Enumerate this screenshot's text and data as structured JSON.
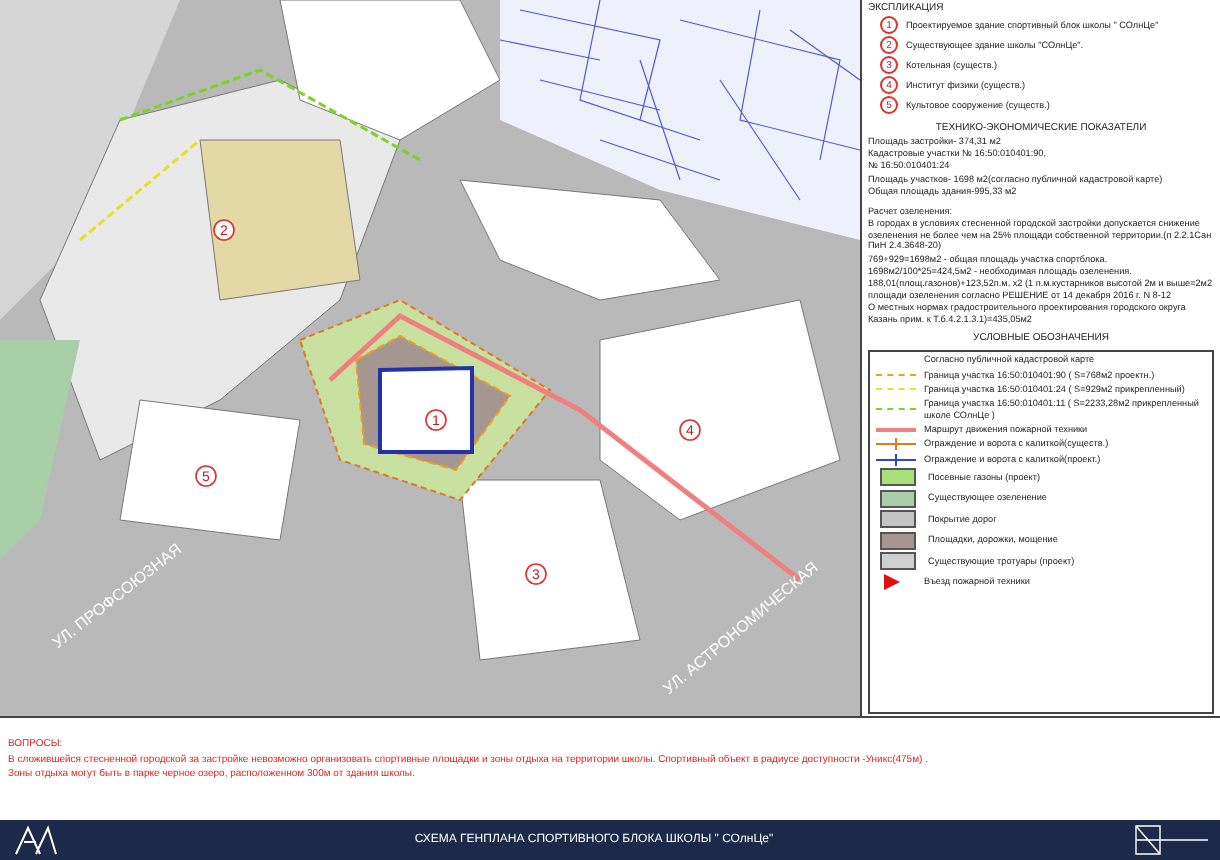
{
  "map": {
    "markers": [
      {
        "number": "1"
      },
      {
        "number": "2"
      },
      {
        "number": "3"
      },
      {
        "number": "4"
      },
      {
        "number": "5"
      }
    ],
    "streets": [
      {
        "name": "УЛ. ПРОФСОЮЗНАЯ"
      },
      {
        "name": "УЛ. АСТРОНОМИЧЕСКАЯ"
      }
    ]
  },
  "explication": {
    "title": "ЭКСПЛИКАЦИЯ",
    "items": [
      {
        "number": "1",
        "text": "Проектируемое здание спортивный блок школы \" СОлнЦе\""
      },
      {
        "number": "2",
        "text": "Существующее здание школы \"СОлнЦе\"."
      },
      {
        "number": "3",
        "text": "Котельная (существ.)"
      },
      {
        "number": "4",
        "text": "Институт физики (существ.)"
      },
      {
        "number": "5",
        "text": "Культовое сооружение (существ.)"
      }
    ]
  },
  "tep": {
    "title": "ТЕХНИКО-ЭКОНОМИЧЕСКИЕ ПОКАЗАТЕЛИ",
    "lines": [
      "Площадь застройки- 374,31 м2",
      "Кадастровые участки № 16:50:010401:90,",
      "№ 16:50:010401:24",
      "Площадь участков- 1698 м2(согласно публичной кадастровой карте)",
      "Общая площадь здания-995,33 м2"
    ]
  },
  "greening": {
    "title": "Расчет озеленения:",
    "paragraphs": [
      "В городах в условиях стесненной городской застройки допускается снижение озеленения не более чем на 25% площади собственной территории.(п 2.2.1Сан ПиН  2.4.3648-20)",
      "769+929=1698м2 - общая площадь участка спортблока.",
      "1698м2/100*25=424,5м2 - необходимая площадь озеленения.",
      "188,01(площ.газонов)+123,52п.м. х2 (1 п.м.кустарников высотой 2м и выше=2м2 площади озеленения согласно РЕШЕНИЕ от 14 декабря 2016 г. N 8-12",
      "О местных нормах градостроительного проектирования городского округа Казань  прим. к Т.б.4.2.1.3.1)=435,05м2"
    ]
  },
  "legend": {
    "title": "УСЛОВНЫЕ ОБОЗНАЧЕНИЯ",
    "items": [
      {
        "kind": "note",
        "text": "Согласно публичной кадастровой карте"
      },
      {
        "kind": "dashed",
        "color": "#f39c1e",
        "text": "Граница участка 16:50:010401:90 ( S=768м2 проектн.)"
      },
      {
        "kind": "dashed",
        "color": "#e8e020",
        "text": "Граница участка 16:50:010401:24 ( S=929м2 прикрепленный)"
      },
      {
        "kind": "dashed",
        "color": "#7ed321",
        "text": "Граница участка 16:50:010401:11 ( S=2233,28м2 прикрепленный школе СОлнЦе )"
      },
      {
        "kind": "solid",
        "color": "#f08080",
        "text": "Маршрут движения пожарной техники"
      },
      {
        "kind": "fence",
        "color": "#e07b20",
        "text": "Ограждение и ворота с калиткой(существ.)"
      },
      {
        "kind": "fence",
        "color": "#3344cc",
        "text": "Ограждение и ворота с калиткой(проект.)"
      },
      {
        "kind": "swatch",
        "color": "#a8e07a",
        "text": "Посевные газоны (проект)"
      },
      {
        "kind": "swatch",
        "color": "#a9cfa9",
        "text": "Существующее озеленение"
      },
      {
        "kind": "swatch",
        "color": "#c4c4c4",
        "text": "Покрытие дорог"
      },
      {
        "kind": "swatch",
        "color": "#a59692",
        "text": "Площадки, дорожки, мощение"
      },
      {
        "kind": "swatch",
        "color": "#cfcfcf",
        "text": "Существующие тротуары (проект)"
      },
      {
        "kind": "arrow",
        "color": "#e01010",
        "text": "Въезд пожарной техники"
      }
    ]
  },
  "questions": {
    "title": "ВОПРОСЫ:",
    "lines": [
      "В сложившейся стесненной городской за застройке невозможно организовать спортивные площадки и зоны отдыха на территории школы. Спортивный объект в радиусе доступности -Уникс(475м) .",
      "Зоны отдыха могут быть в парке черное озеро, расположенном 300м от здания школы."
    ]
  },
  "footer": {
    "title": "СХЕМА ГЕНПЛАНА СПОРТИВНОГО БЛОКА ШКОЛЫ \" СОлнЦе\""
  }
}
